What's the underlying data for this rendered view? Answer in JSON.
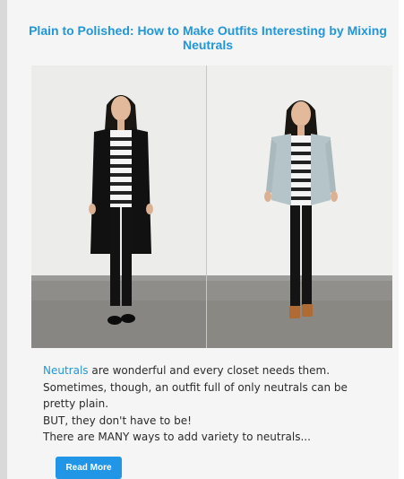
{
  "post": {
    "title": "Plain to Polished: How to Make Outfits Interesting by Mixing Neutrals",
    "excerpt": {
      "link_text": "Neutrals",
      "line1_rest": " are wonderful and every closet needs them.",
      "line2": "Sometimes, though, an outfit full of only neutrals can be",
      "line3": "pretty plain.",
      "line4": "BUT, they don't have to be!",
      "line5": "There are MANY ways to add variety to neutrals..."
    },
    "read_more_label": "Read More"
  },
  "colors": {
    "accent": "#2196d8",
    "button": "#2196e6",
    "card_background": "#f5f5f5",
    "text": "#2b2b2b"
  }
}
